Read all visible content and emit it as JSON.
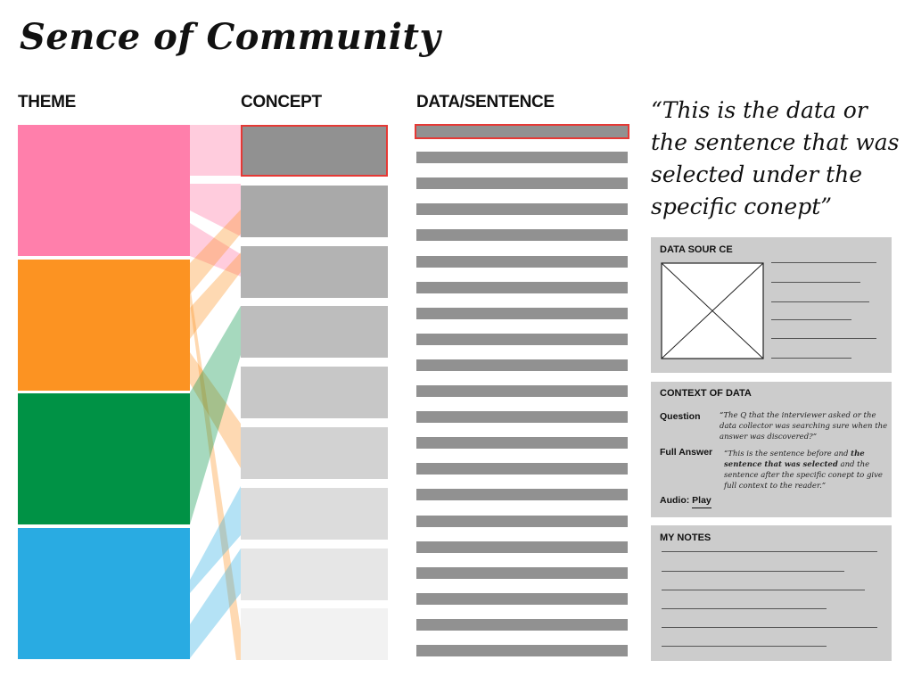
{
  "title": "Sence of Community",
  "columns": {
    "theme": "THEME",
    "concept": "CONCEPT",
    "data": "DATA/SENTENCE"
  },
  "themes": [
    {
      "color": "#ff7fab"
    },
    {
      "color": "#fc9322"
    },
    {
      "color": "#009245"
    },
    {
      "color": "#29abe2"
    }
  ],
  "concepts": [
    {
      "color": "#919191",
      "selected": true
    },
    {
      "color": "#a9a9a9"
    },
    {
      "color": "#b3b3b3"
    },
    {
      "color": "#bdbdbd"
    },
    {
      "color": "#c7c7c7"
    },
    {
      "color": "#d2d2d2"
    },
    {
      "color": "#dcdcdc"
    },
    {
      "color": "#e6e6e6"
    },
    {
      "color": "#f2f2f2"
    }
  ],
  "data_sentence_count": 21,
  "selected_data_index": 0,
  "quote": "“This is the data or the sentence that was selected under the specific conept”",
  "data_source": {
    "heading": "DATA SOUR CE"
  },
  "context": {
    "heading": "CONTEXT OF DATA",
    "question_label": "Question",
    "question_text": "“The Q that the interviewer asked or the data collector was searching sure when the answer was discovered?”",
    "full_answer_label": "Full Answer",
    "answer_before": "“This is the sentence before and ",
    "answer_selected": "the sentence that was selected",
    "answer_after": " and the sentence after the specific conept to give full context to the reader.”",
    "audio_label": "Audio:",
    "audio_link": "Play"
  },
  "notes": {
    "heading": "MY NOTES"
  }
}
